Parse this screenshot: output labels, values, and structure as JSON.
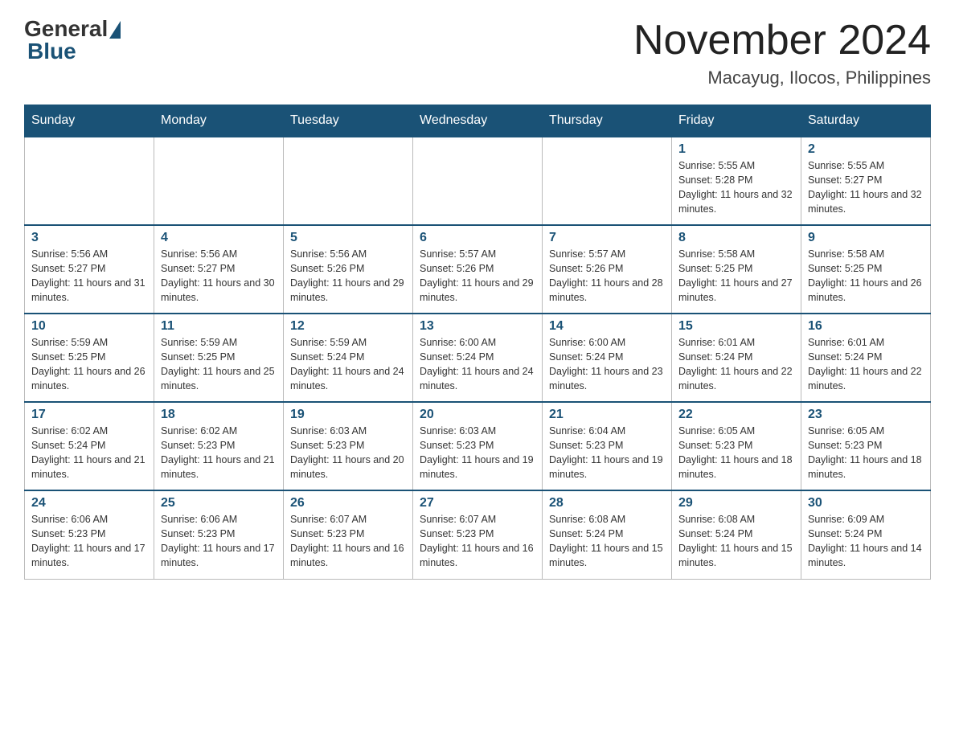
{
  "logo": {
    "general": "General",
    "blue": "Blue"
  },
  "title": "November 2024",
  "subtitle": "Macayug, Ilocos, Philippines",
  "days_of_week": [
    "Sunday",
    "Monday",
    "Tuesday",
    "Wednesday",
    "Thursday",
    "Friday",
    "Saturday"
  ],
  "weeks": [
    {
      "days": [
        {
          "number": "",
          "info": ""
        },
        {
          "number": "",
          "info": ""
        },
        {
          "number": "",
          "info": ""
        },
        {
          "number": "",
          "info": ""
        },
        {
          "number": "",
          "info": ""
        },
        {
          "number": "1",
          "info": "Sunrise: 5:55 AM\nSunset: 5:28 PM\nDaylight: 11 hours and 32 minutes."
        },
        {
          "number": "2",
          "info": "Sunrise: 5:55 AM\nSunset: 5:27 PM\nDaylight: 11 hours and 32 minutes."
        }
      ]
    },
    {
      "days": [
        {
          "number": "3",
          "info": "Sunrise: 5:56 AM\nSunset: 5:27 PM\nDaylight: 11 hours and 31 minutes."
        },
        {
          "number": "4",
          "info": "Sunrise: 5:56 AM\nSunset: 5:27 PM\nDaylight: 11 hours and 30 minutes."
        },
        {
          "number": "5",
          "info": "Sunrise: 5:56 AM\nSunset: 5:26 PM\nDaylight: 11 hours and 29 minutes."
        },
        {
          "number": "6",
          "info": "Sunrise: 5:57 AM\nSunset: 5:26 PM\nDaylight: 11 hours and 29 minutes."
        },
        {
          "number": "7",
          "info": "Sunrise: 5:57 AM\nSunset: 5:26 PM\nDaylight: 11 hours and 28 minutes."
        },
        {
          "number": "8",
          "info": "Sunrise: 5:58 AM\nSunset: 5:25 PM\nDaylight: 11 hours and 27 minutes."
        },
        {
          "number": "9",
          "info": "Sunrise: 5:58 AM\nSunset: 5:25 PM\nDaylight: 11 hours and 26 minutes."
        }
      ]
    },
    {
      "days": [
        {
          "number": "10",
          "info": "Sunrise: 5:59 AM\nSunset: 5:25 PM\nDaylight: 11 hours and 26 minutes."
        },
        {
          "number": "11",
          "info": "Sunrise: 5:59 AM\nSunset: 5:25 PM\nDaylight: 11 hours and 25 minutes."
        },
        {
          "number": "12",
          "info": "Sunrise: 5:59 AM\nSunset: 5:24 PM\nDaylight: 11 hours and 24 minutes."
        },
        {
          "number": "13",
          "info": "Sunrise: 6:00 AM\nSunset: 5:24 PM\nDaylight: 11 hours and 24 minutes."
        },
        {
          "number": "14",
          "info": "Sunrise: 6:00 AM\nSunset: 5:24 PM\nDaylight: 11 hours and 23 minutes."
        },
        {
          "number": "15",
          "info": "Sunrise: 6:01 AM\nSunset: 5:24 PM\nDaylight: 11 hours and 22 minutes."
        },
        {
          "number": "16",
          "info": "Sunrise: 6:01 AM\nSunset: 5:24 PM\nDaylight: 11 hours and 22 minutes."
        }
      ]
    },
    {
      "days": [
        {
          "number": "17",
          "info": "Sunrise: 6:02 AM\nSunset: 5:24 PM\nDaylight: 11 hours and 21 minutes."
        },
        {
          "number": "18",
          "info": "Sunrise: 6:02 AM\nSunset: 5:23 PM\nDaylight: 11 hours and 21 minutes."
        },
        {
          "number": "19",
          "info": "Sunrise: 6:03 AM\nSunset: 5:23 PM\nDaylight: 11 hours and 20 minutes."
        },
        {
          "number": "20",
          "info": "Sunrise: 6:03 AM\nSunset: 5:23 PM\nDaylight: 11 hours and 19 minutes."
        },
        {
          "number": "21",
          "info": "Sunrise: 6:04 AM\nSunset: 5:23 PM\nDaylight: 11 hours and 19 minutes."
        },
        {
          "number": "22",
          "info": "Sunrise: 6:05 AM\nSunset: 5:23 PM\nDaylight: 11 hours and 18 minutes."
        },
        {
          "number": "23",
          "info": "Sunrise: 6:05 AM\nSunset: 5:23 PM\nDaylight: 11 hours and 18 minutes."
        }
      ]
    },
    {
      "days": [
        {
          "number": "24",
          "info": "Sunrise: 6:06 AM\nSunset: 5:23 PM\nDaylight: 11 hours and 17 minutes."
        },
        {
          "number": "25",
          "info": "Sunrise: 6:06 AM\nSunset: 5:23 PM\nDaylight: 11 hours and 17 minutes."
        },
        {
          "number": "26",
          "info": "Sunrise: 6:07 AM\nSunset: 5:23 PM\nDaylight: 11 hours and 16 minutes."
        },
        {
          "number": "27",
          "info": "Sunrise: 6:07 AM\nSunset: 5:23 PM\nDaylight: 11 hours and 16 minutes."
        },
        {
          "number": "28",
          "info": "Sunrise: 6:08 AM\nSunset: 5:24 PM\nDaylight: 11 hours and 15 minutes."
        },
        {
          "number": "29",
          "info": "Sunrise: 6:08 AM\nSunset: 5:24 PM\nDaylight: 11 hours and 15 minutes."
        },
        {
          "number": "30",
          "info": "Sunrise: 6:09 AM\nSunset: 5:24 PM\nDaylight: 11 hours and 14 minutes."
        }
      ]
    }
  ]
}
